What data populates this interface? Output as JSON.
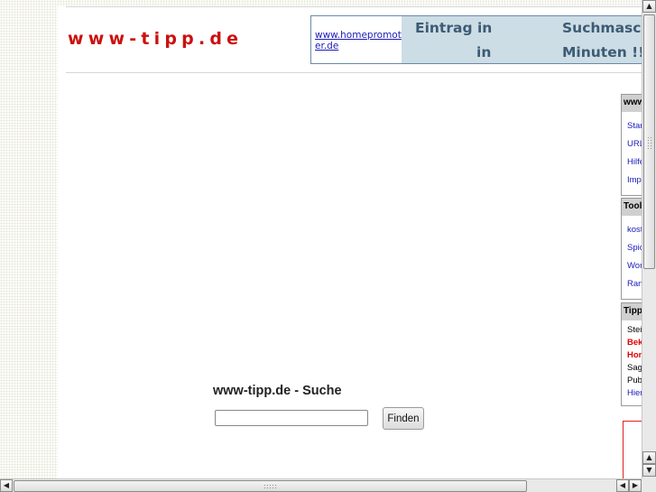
{
  "header": {
    "logo": "www-tipp.de"
  },
  "banner": {
    "link_text": "www.homepromoter.de",
    "text_1": "Eintrag in",
    "text_2": "Suchmasch",
    "text_3": "in",
    "text_4": "Minuten !!"
  },
  "sidebar": {
    "box1": {
      "title": "www",
      "items": [
        "Star",
        "URL",
        "Hilfe",
        "Impr"
      ]
    },
    "box2": {
      "title": "Tool",
      "items": [
        "kost",
        "Spic",
        "Wor",
        "Ran"
      ]
    },
    "box3": {
      "title": "Tipp",
      "items": [
        "Steig",
        "Bek",
        "Hom",
        "Sage",
        "Pub",
        "Hier"
      ]
    }
  },
  "search": {
    "title": "www-tipp.de - Suche",
    "input_value": "",
    "button_label": "Finden"
  },
  "colors": {
    "logo": "#cc1010",
    "link": "#1a1ab8",
    "banner_bg": "#ccdde5",
    "accent_red": "#e00000"
  }
}
